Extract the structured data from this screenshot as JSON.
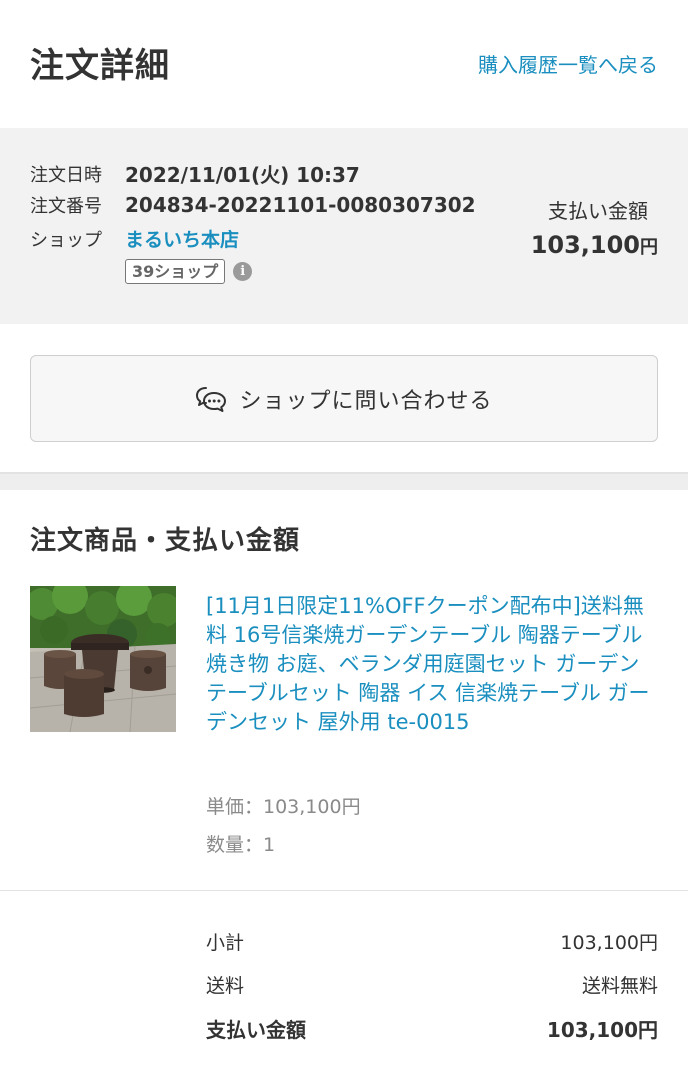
{
  "header": {
    "title": "注文詳細",
    "back_link": "購入履歴一覧へ戻る"
  },
  "order": {
    "date_label": "注文日時",
    "date_value": "2022/11/01(火) 10:37",
    "number_label": "注文番号",
    "number_value": "204834-20221101-0080307302",
    "shop_label": "ショップ",
    "shop_value": "まるいち本店",
    "shop_badge": "39ショップ",
    "info_icon": "i",
    "payment_label": "支払い金額",
    "payment_amount": "103,100",
    "payment_unit": "円"
  },
  "contact": {
    "label": "ショップに問い合わせる",
    "icon": "chat-bubbles-icon"
  },
  "items_section": {
    "title": "注文商品・支払い金額",
    "product": {
      "name": "[11月1日限定11%OFFクーポン配布中]送料無料 16号信楽焼ガーデンテーブル 陶器テーブル 焼き物 お庭、ベランダ用庭園セット ガーデンテーブルセット 陶器 イス 信楽焼テーブル ガーデンセット 屋外用 te-0015",
      "unit_price": "単価：103,100円",
      "quantity": "数量：1"
    }
  },
  "totals": {
    "subtotal_label": "小計",
    "subtotal_value": "103,100円",
    "shipping_label": "送料",
    "shipping_value": "送料無料",
    "payment_label": "支払い金額",
    "payment_value": "103,100円"
  },
  "colors": {
    "link": "#1a8fbf",
    "text": "#333333",
    "muted": "#8a8a8a",
    "panel": "#f2f2f2"
  }
}
